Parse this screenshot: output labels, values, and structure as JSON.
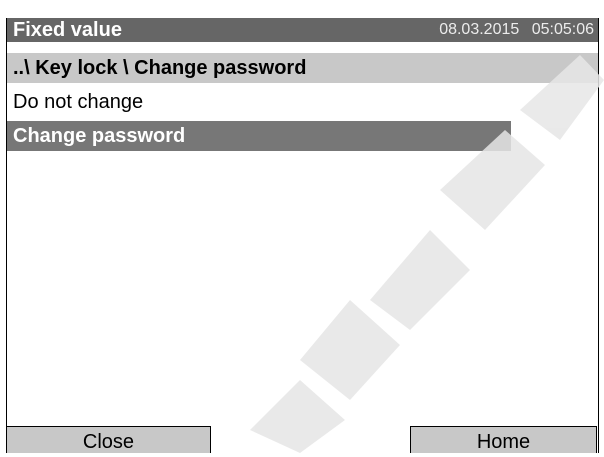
{
  "header": {
    "title": "Fixed value",
    "date": "08.03.2015",
    "time": "05:05:06"
  },
  "breadcrumb": "..\\ Key lock \\ Change password",
  "options": [
    {
      "label": "Do not change"
    },
    {
      "label": "Change password"
    }
  ],
  "footer": {
    "close_label": "Close",
    "home_label": "Home"
  },
  "colors": {
    "titlebar": "#666666",
    "pathbar": "#c8c8c8",
    "selected": "#777777",
    "buttons": "#c8c8c8"
  }
}
